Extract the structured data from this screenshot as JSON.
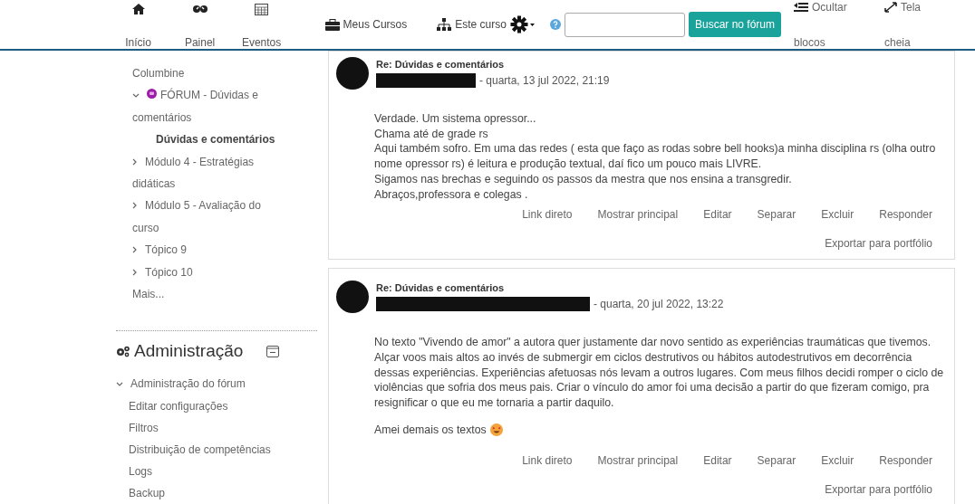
{
  "navbar": {
    "primary": [
      {
        "label": "Início"
      },
      {
        "label": "Painel"
      },
      {
        "label": "Eventos"
      }
    ],
    "links": [
      {
        "label": "Meus Cursos"
      },
      {
        "label": "Este curso"
      }
    ],
    "search": {
      "button": "Buscar no fórum"
    },
    "toggles": [
      {
        "top": "Ocultar",
        "bottom": "blocos"
      },
      {
        "top": "Tela",
        "bottom": "cheia"
      }
    ]
  },
  "sidebar": {
    "items": [
      {
        "label": "Columbine",
        "kind": "text",
        "selected": false
      },
      {
        "label": "FÓRUM - Dúvidas e comentários",
        "kind": "forum",
        "expanded": true,
        "selected": false,
        "children": [
          {
            "label": "Dúvidas e comentários",
            "selected": true
          }
        ]
      },
      {
        "label": "Módulo 4 - Estratégias didáticas",
        "kind": "section",
        "expanded": false,
        "selected": false
      },
      {
        "label": "Módulo 5 - Avaliação do curso",
        "kind": "section",
        "expanded": false,
        "selected": false
      },
      {
        "label": "Tópico 9",
        "kind": "section",
        "expanded": false,
        "selected": false
      },
      {
        "label": "Tópico 10",
        "kind": "section",
        "expanded": false,
        "selected": false
      },
      {
        "label": "Mais...",
        "kind": "text",
        "selected": false
      }
    ]
  },
  "admin": {
    "title": "Administração",
    "items": [
      {
        "label": "Administração do fórum",
        "expanded": true,
        "children": [
          {
            "label": "Editar configurações"
          },
          {
            "label": "Filtros"
          },
          {
            "label": "Distribuição de competências"
          },
          {
            "label": "Logs"
          },
          {
            "label": "Backup"
          }
        ]
      }
    ]
  },
  "posts": [
    {
      "title": "Re: Dúvidas e comentários",
      "date": "- quarta, 13 jul 2022, 21:19",
      "lines": [
        "Verdade. Um sistema opressor...",
        "Chama até de grade rs",
        "Aqui também sofro. Em uma das redes ( esta que faço as rodas sobre bell hooks)a minha disciplina rs (olha outro nome opressor rs) é leitura e produção textual, daí fico um pouco mais LIVRE.",
        "Sigamos nas brechas e seguindo os passos da mestra que nos ensina a transgredir.",
        "Abraços,professora e colegas ."
      ],
      "actions": [
        "Link direto",
        "Mostrar principal",
        "Editar",
        "Separar",
        "Excluir",
        "Responder"
      ],
      "export": "Exportar para portfólio"
    },
    {
      "title": "Re: Dúvidas e comentários",
      "date": "- quarta, 20 jul 2022, 13:22",
      "paragraphs": [
        {
          "text": "No texto \"Vivendo de amor\" a autora quer justamente dar novo sentido as experiências traumáticas que tivemos. Alçar voos mais altos ao invés de submergir em ciclos destrutivos ou hábitos autodestrutivos em decorrência dessas experiências. Experiências afetuosas nós levam a outros lugares. Com meus filhos decidi romper o ciclo de violências que sofria dos meus pais. Criar o vínculo do amor foi uma decisão a partir do que fizeram comigo, pra resignificar o que eu me tornaria a partir daquilo.",
          "emoji": false
        },
        {
          "text": "Amei demais os textos",
          "emoji": true
        }
      ],
      "actions": [
        "Link direto",
        "Mostrar principal",
        "Editar",
        "Separar",
        "Excluir",
        "Responder"
      ],
      "export": "Exportar para portfólio"
    }
  ]
}
